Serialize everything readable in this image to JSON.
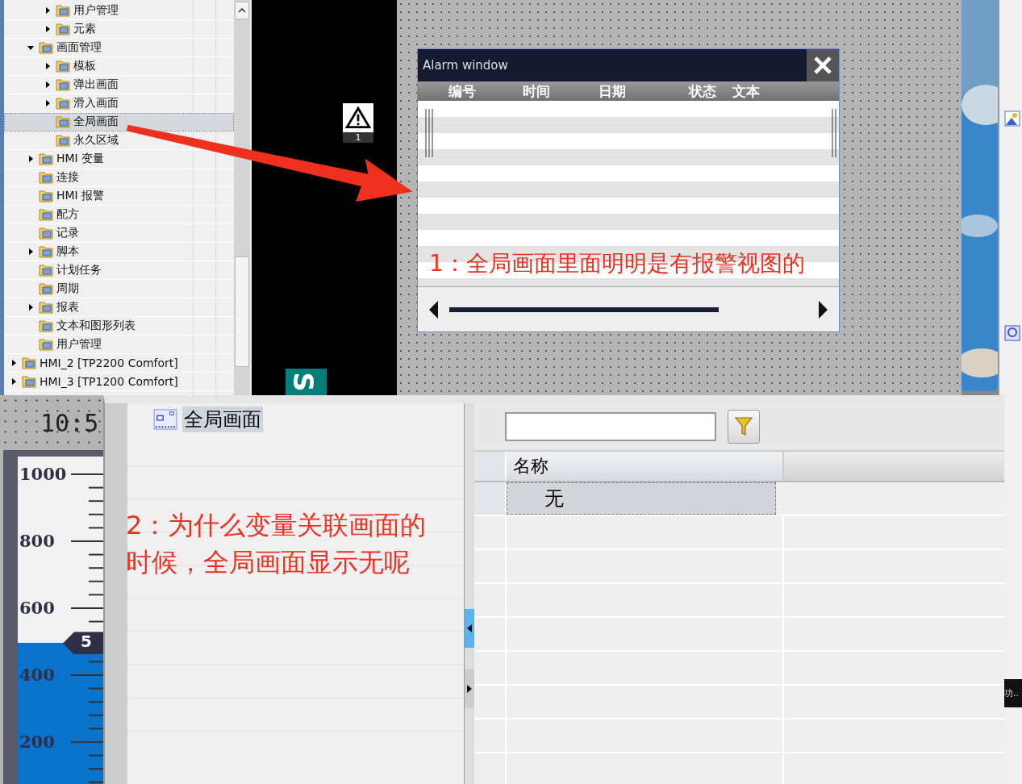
{
  "project_tree": {
    "items": [
      {
        "children": [
          {
            "children": [
              {
                "label": "用户管理",
                "expanded": false,
                "selected": false
              },
              {
                "label": "元素",
                "expanded": false,
                "selected": false
              }
            ]
          },
          {
            "label": "画面管理",
            "expanded": true,
            "selected": false,
            "children": [
              {
                "label": "模板",
                "expanded": false,
                "selected": false
              },
              {
                "label": "弹出画面",
                "expanded": false,
                "selected": false
              },
              {
                "label": "滑入画面",
                "expanded": false,
                "selected": false
              },
              {
                "label": "全局画面",
                "selected": true
              },
              {
                "label": "永久区域",
                "selected": false
              }
            ]
          },
          {
            "label": "HMI 变量",
            "expanded": false,
            "selected": false
          },
          {
            "label": "连接",
            "selected": false
          },
          {
            "label": "HMI 报警",
            "selected": false
          },
          {
            "label": "配方",
            "selected": false
          },
          {
            "label": "记录",
            "selected": false
          },
          {
            "label": "脚本",
            "expanded": false,
            "selected": false
          },
          {
            "label": "计划任务",
            "selected": false
          },
          {
            "label": "周期",
            "selected": false
          },
          {
            "label": "报表",
            "expanded": false,
            "selected": false
          },
          {
            "label": "文本和图形列表",
            "selected": false
          },
          {
            "label": "用户管理",
            "selected": false
          }
        ]
      },
      {
        "label": "HMI_2 [TP2200 Comfort]",
        "expanded": false,
        "selected": false
      },
      {
        "label": "HMI_3 [TP1200 Comfort]",
        "expanded": false,
        "selected": false
      }
    ]
  },
  "warning_indicator": {
    "count": "1"
  },
  "logo_text": "S",
  "alarm_window": {
    "title": "Alarm window",
    "columns": [
      "编号",
      "时间",
      "日期",
      "状态",
      "文本"
    ]
  },
  "annotations": [
    "1：全局画面里面明明是有报警视图的",
    "2：为什么变量关联画面的时候，全局画面显示无呢"
  ],
  "clock": "10:5",
  "gauge": {
    "labels": [
      "1000",
      "800",
      "600",
      "400",
      "200"
    ],
    "level": 0.43,
    "marker": "5"
  },
  "screen_list": {
    "items": [
      {
        "label": "全局画面",
        "selected": true
      }
    ]
  },
  "picker_table": {
    "columns": [
      "名称"
    ],
    "rows": [
      {
        "name": "无",
        "selected": true
      }
    ]
  },
  "status_text": "功.."
}
